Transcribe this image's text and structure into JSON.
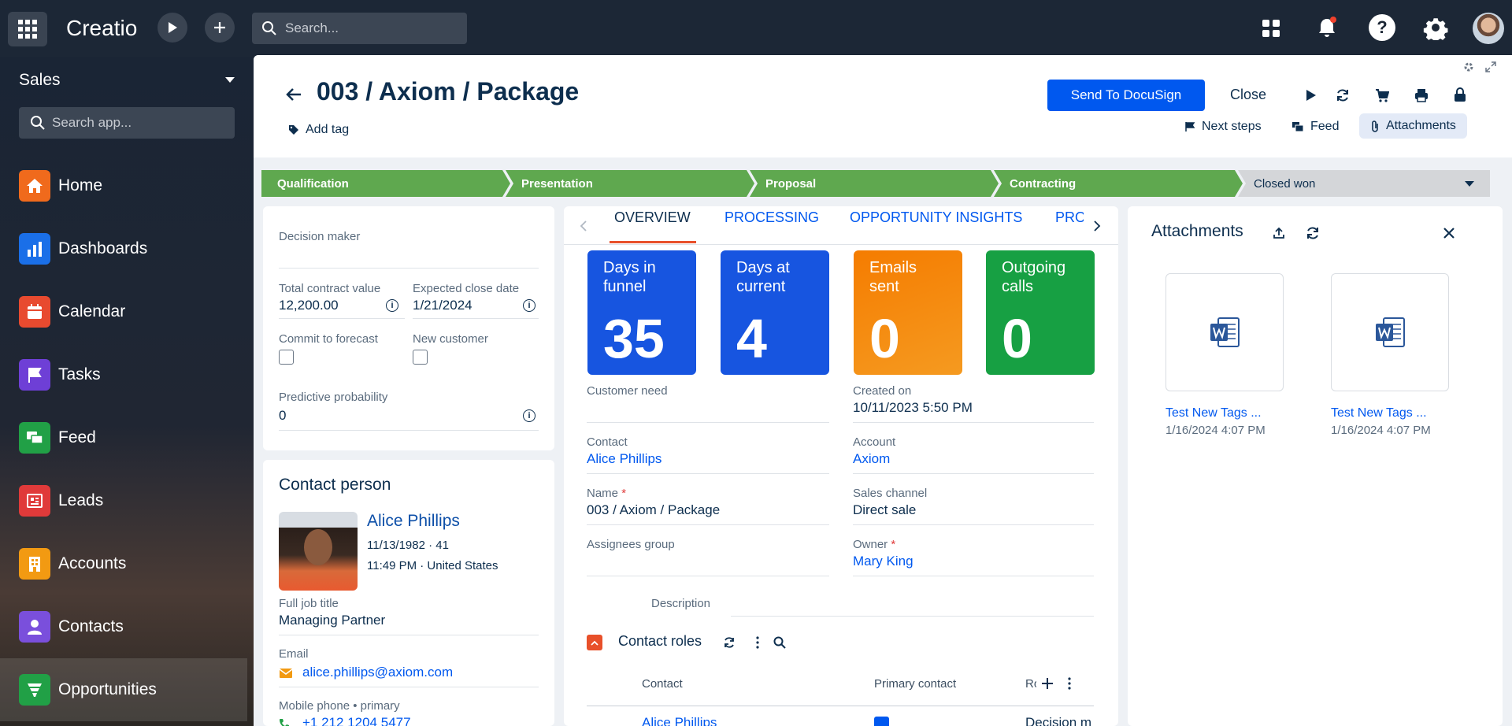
{
  "topbar": {
    "logo": "Creatio",
    "search_placeholder": "Search..."
  },
  "sidebar": {
    "app_title": "Sales",
    "search_placeholder": "Search app...",
    "items": [
      {
        "label": "Home",
        "color": "#f06a1c"
      },
      {
        "label": "Dashboards",
        "color": "#1a6fe8"
      },
      {
        "label": "Calendar",
        "color": "#e84a2f"
      },
      {
        "label": "Tasks",
        "color": "#6e3fd6"
      },
      {
        "label": "Feed",
        "color": "#21a046"
      },
      {
        "label": "Leads",
        "color": "#e03a3a"
      },
      {
        "label": "Accounts",
        "color": "#f29a12"
      },
      {
        "label": "Contacts",
        "color": "#7a4fdc"
      },
      {
        "label": "Opportunities",
        "color": "#21a046"
      }
    ]
  },
  "header": {
    "title": "003 / Axiom / Package",
    "add_tag": "Add tag",
    "docusign_button": "Send To DocuSign",
    "close_button": "Close",
    "next_steps": "Next steps",
    "feed": "Feed",
    "attachments": "Attachments"
  },
  "stages": [
    {
      "label": "Qualification",
      "state": "done"
    },
    {
      "label": "Presentation",
      "state": "done"
    },
    {
      "label": "Proposal",
      "state": "done"
    },
    {
      "label": "Contracting",
      "state": "done"
    },
    {
      "label": "Closed won",
      "state": "pending"
    }
  ],
  "left_card": {
    "decision_maker_label": "Decision maker",
    "total_contract_label": "Total contract value",
    "total_contract_value": "12,200.00",
    "close_date_label": "Expected close date",
    "close_date_value": "1/21/2024",
    "commit_label": "Commit to forecast",
    "new_customer_label": "New customer",
    "predictive_label": "Predictive probability",
    "predictive_value": "0"
  },
  "contact_card": {
    "title": "Contact person",
    "name": "Alice Phillips",
    "dob": "11/13/1982 · 41",
    "time_location": "11:49 PM · United States",
    "job_label": "Full job title",
    "job_value": "Managing Partner",
    "email_label": "Email",
    "email_value": "alice.phillips@axiom.com",
    "mobile_label": "Mobile phone • primary",
    "mobile_value": "+1 212 1204 5477"
  },
  "tabs": [
    "OVERVIEW",
    "PROCESSING",
    "OPPORTUNITY INSIGHTS",
    "PRO"
  ],
  "tiles": [
    {
      "title": "Days in funnel",
      "value": "35",
      "color": "#1755e0"
    },
    {
      "title": "Days at current",
      "value": "4",
      "color": "#1755e0"
    },
    {
      "title": "Emails sent",
      "value": "0",
      "color": "#f57c00"
    },
    {
      "title": "Outgoing calls",
      "value": "0",
      "color": "#17a043"
    }
  ],
  "fields": {
    "customer_need_label": "Customer need",
    "created_on_label": "Created on",
    "created_on_value": "10/11/2023 5:50 PM",
    "contact_label": "Contact",
    "contact_value": "Alice Phillips",
    "account_label": "Account",
    "account_value": "Axiom",
    "name_label": "Name",
    "name_value": "003 / Axiom / Package",
    "sales_channel_label": "Sales channel",
    "sales_channel_value": "Direct sale",
    "assignees_label": "Assignees group",
    "owner_label": "Owner",
    "owner_value": "Mary King",
    "description_label": "Description"
  },
  "contact_roles": {
    "title": "Contact roles",
    "col_contact": "Contact",
    "col_primary": "Primary contact",
    "col_role": "Ro",
    "row_contact": "Alice Phillips",
    "row_role": "Decision m"
  },
  "attachments_panel": {
    "title": "Attachments",
    "files": [
      {
        "name": "Test New Tags ...",
        "date": "1/16/2024 4:07 PM"
      },
      {
        "name": "Test New Tags ...",
        "date": "1/16/2024 4:07 PM"
      }
    ]
  }
}
